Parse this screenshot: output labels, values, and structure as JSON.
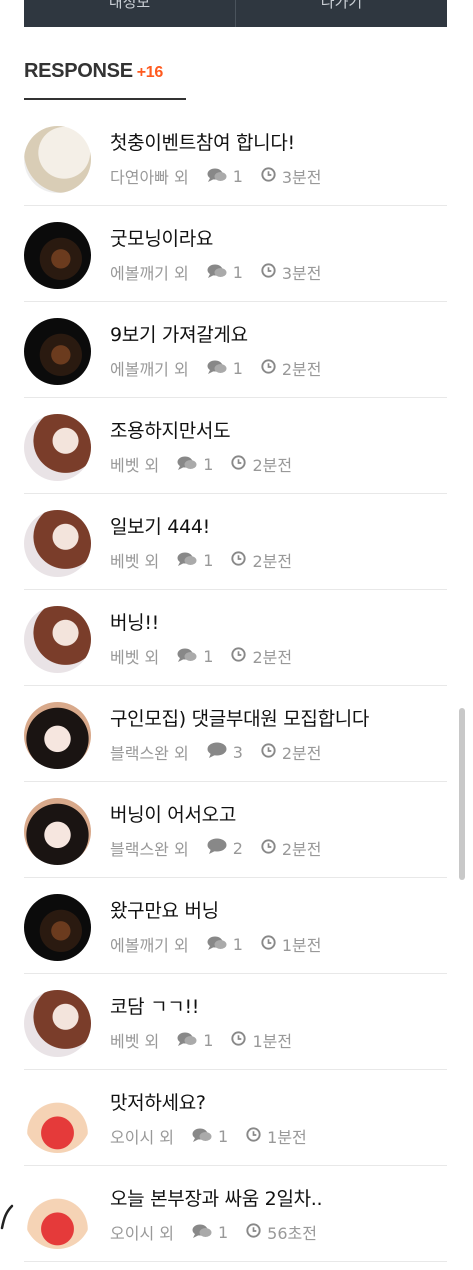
{
  "topbar": {
    "left_button": "내정보",
    "right_button": "나가기"
  },
  "section": {
    "title": "RESPONSE",
    "count": "+16"
  },
  "posts": [
    {
      "title": "첫충이벤트참여 합니다!",
      "author": "다연아빠 외",
      "comments": "1",
      "time": "3분전",
      "avatar": "baby",
      "icon": "comments-icon"
    },
    {
      "title": "굿모닝이라요",
      "author": "에볼깨기 외",
      "comments": "1",
      "time": "3분전",
      "avatar": "dark",
      "icon": "comments-icon"
    },
    {
      "title": "9보기 가져갈게요",
      "author": "에볼깨기 외",
      "comments": "1",
      "time": "2분전",
      "avatar": "dark",
      "icon": "comments-icon"
    },
    {
      "title": "조용하지만서도",
      "author": "베벳 외",
      "comments": "1",
      "time": "2분전",
      "avatar": "woman",
      "icon": "comments-icon"
    },
    {
      "title": "일보기 444!",
      "author": "베벳 외",
      "comments": "1",
      "time": "2분전",
      "avatar": "woman",
      "icon": "comments-icon"
    },
    {
      "title": "버닝!!",
      "author": "베벳 외",
      "comments": "1",
      "time": "2분전",
      "avatar": "woman",
      "icon": "comments-icon"
    },
    {
      "title": "구인모집) 댓글부대원 모집합니다",
      "author": "블랙스완 외",
      "comments": "3",
      "time": "2분전",
      "avatar": "girl",
      "icon": "comment-icon"
    },
    {
      "title": "버닝이 어서오고",
      "author": "블랙스완 외",
      "comments": "2",
      "time": "2분전",
      "avatar": "girl",
      "icon": "comment-icon"
    },
    {
      "title": "왔구만요 버닝",
      "author": "에볼깨기 외",
      "comments": "1",
      "time": "1분전",
      "avatar": "dark",
      "icon": "comments-icon"
    },
    {
      "title": "코담 ㄱㄱ!!",
      "author": "베벳 외",
      "comments": "1",
      "time": "1분전",
      "avatar": "woman",
      "icon": "comments-icon"
    },
    {
      "title": "맛저하세요?",
      "author": "오이시 외",
      "comments": "1",
      "time": "1분전",
      "avatar": "shin",
      "icon": "comments-icon"
    },
    {
      "title": "오늘 본부장과 싸움 2일차..",
      "author": "오이시 외",
      "comments": "1",
      "time": "56초전",
      "avatar": "shin",
      "icon": "comments-icon"
    }
  ],
  "colors": {
    "accent": "#ff5a1f",
    "topbar": "#2f3740",
    "meta": "#999999"
  }
}
